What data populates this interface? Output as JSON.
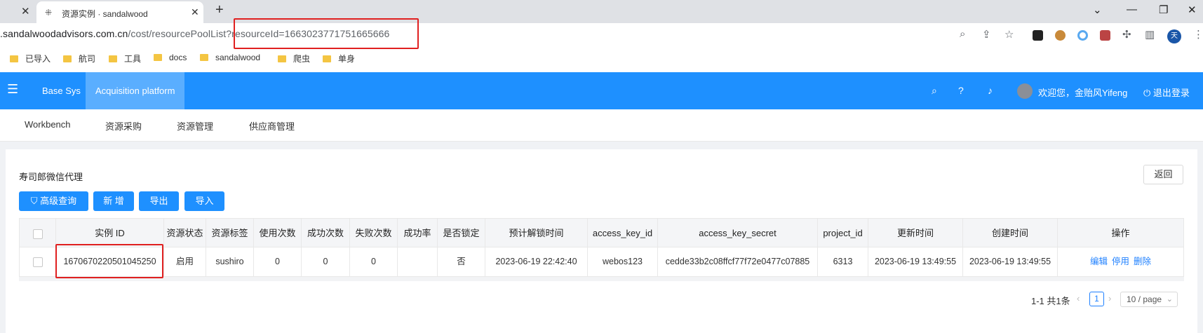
{
  "browser": {
    "tab_title": "资源实例 · sandalwood",
    "url_host": ".sandalwoodadvisors.com.cn",
    "url_path": "/cost/resourcePoolList",
    "url_query": "?resourceId=1663023771751665666",
    "profile_initial": "天",
    "bookmarks": [
      "已导入",
      "航司",
      "工具",
      "docs",
      "sandalwood",
      "爬虫",
      "单身"
    ]
  },
  "header": {
    "nav": [
      "Base Sys",
      "Acquisition platform"
    ],
    "active_nav": "Acquisition platform",
    "welcome": "欢迎您，金贻风Yifeng",
    "logout": "退出登录",
    "brand_color": "#1e90ff"
  },
  "submenu": [
    "Workbench",
    "资源采购",
    "资源管理",
    "供应商管理"
  ],
  "page": {
    "title": "寿司郎微信代理",
    "back": "返回",
    "buttons": {
      "advanced_query": "高级查询",
      "add": "新 增",
      "export": "导出",
      "import": "导入"
    }
  },
  "table": {
    "columns": [
      "实例 ID",
      "资源状态",
      "资源标签",
      "使用次数",
      "成功次数",
      "失败次数",
      "成功率",
      "是否锁定",
      "预计解锁时间",
      "access_key_id",
      "access_key_secret",
      "project_id",
      "更新时间",
      "创建时间",
      "操作"
    ],
    "rows": [
      {
        "id": "1670670220501045250",
        "status": "启用",
        "tag": "sushiro",
        "use_count": "0",
        "success_count": "0",
        "fail_count": "0",
        "success_rate": "",
        "locked": "否",
        "unlock_time": "2023-06-19 22:42:40",
        "access_key_id": "webos123",
        "access_key_secret": "cedde33b2c08ffcf77f72e0477c07885",
        "project_id": "6313",
        "updated": "2023-06-19 13:49:55",
        "created": "2023-06-19 13:49:55",
        "actions": [
          "编辑",
          "停用",
          "删除"
        ]
      }
    ]
  },
  "pagination": {
    "total": "1-1 共1条",
    "current": "1",
    "page_size": "10 / page"
  }
}
